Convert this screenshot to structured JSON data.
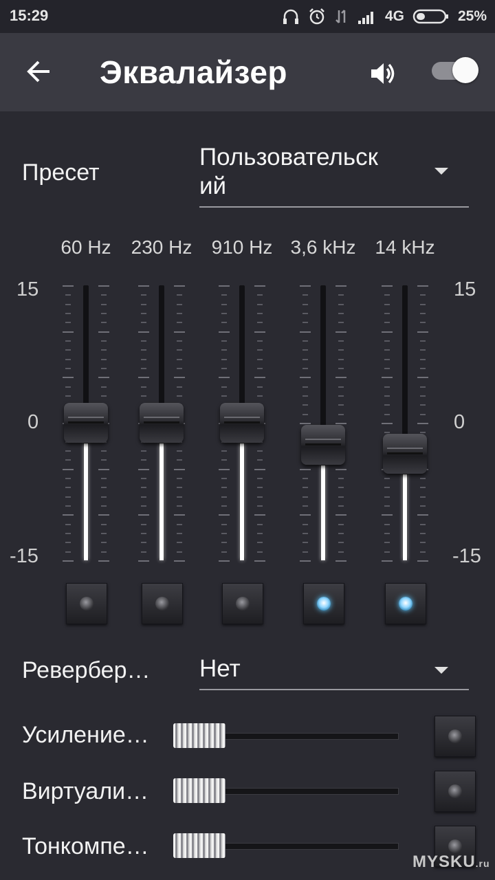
{
  "status_bar": {
    "time": "15:29",
    "network": "4G",
    "battery": "25%"
  },
  "app_bar": {
    "title": "Эквалайзер",
    "enabled": true
  },
  "preset": {
    "label": "Пресет",
    "value_line1": "Пользовательск",
    "value_line2": "ий"
  },
  "equalizer": {
    "scale": {
      "max": "15",
      "mid": "0",
      "min": "-15"
    },
    "bands": [
      {
        "freq": "60 Hz",
        "gain_db": 0,
        "enabled": false
      },
      {
        "freq": "230 Hz",
        "gain_db": 0,
        "enabled": false
      },
      {
        "freq": "910 Hz",
        "gain_db": 0,
        "enabled": false
      },
      {
        "freq": "3,6 kHz",
        "gain_db": -2.4,
        "enabled": true
      },
      {
        "freq": "14 kHz",
        "gain_db": -3.4,
        "enabled": true
      }
    ]
  },
  "reverb": {
    "label": "Ревербер…",
    "value": "Нет"
  },
  "effects": [
    {
      "label": "Усиление…",
      "level": 0,
      "enabled": false
    },
    {
      "label": "Виртуали…",
      "level": 0,
      "enabled": false
    },
    {
      "label": "Тонкомпе…",
      "level": 0,
      "enabled": false
    }
  ],
  "watermark": {
    "text": "MYSKU",
    "suffix": ".ru"
  }
}
